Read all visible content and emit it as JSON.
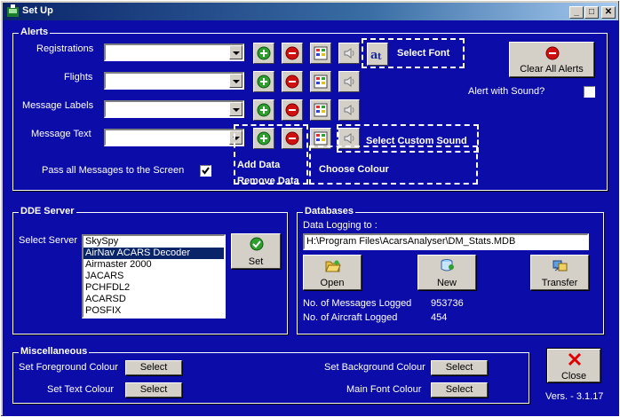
{
  "window": {
    "title": "Set Up",
    "minimize_glyph": "_",
    "maximize_glyph": "□",
    "close_glyph": "✕"
  },
  "alerts": {
    "group_title": "Alerts",
    "rows": [
      {
        "label": "Registrations"
      },
      {
        "label": "Flights"
      },
      {
        "label": "Message Labels"
      },
      {
        "label": "Message Text"
      }
    ],
    "pass_all_label": "Pass all Messages to the Screen",
    "pass_all_checked": true,
    "select_font_label": "Select Font",
    "select_custom_sound_label": "Select Custom Sound",
    "choose_colour_label": "Choose Colour",
    "add_data_label": "Add Data",
    "remove_data_label": "Remove Data",
    "clear_all_alerts_label": "Clear All Alerts",
    "alert_with_sound_label": "Alert with Sound?",
    "alert_with_sound_checked": false
  },
  "dde": {
    "group_title": "DDE Server",
    "select_server_label": "Select Server",
    "servers": [
      "SkySpy",
      "AirNav ACARS Decoder",
      "Airmaster 2000",
      "JACARS",
      "PCHFDL2",
      "ACARSD",
      "POSFIX"
    ],
    "selected_index": 1,
    "set_label": "Set"
  },
  "databases": {
    "group_title": "Databases",
    "data_logging_label": "Data Logging to :",
    "data_logging_path": "H:\\Program Files\\AcarsAnalyser\\DM_Stats.MDB",
    "open_label": "Open",
    "new_label": "New",
    "transfer_label": "Transfer",
    "messages_logged_label": "No. of Messages Logged",
    "messages_logged_value": "953736",
    "aircraft_logged_label": "No. of Aircraft Logged",
    "aircraft_logged_value": "454"
  },
  "misc": {
    "group_title": "Miscellaneous",
    "fg_colour_label": "Set Foreground Colour",
    "text_colour_label": "Set Text Colour",
    "bg_colour_label": "Set Background Colour",
    "main_font_colour_label": "Main Font Colour",
    "select_label": "Select"
  },
  "close_label": "Close",
  "version": "Vers. - 3.1.17",
  "colors": {
    "background": "#0c0ca8",
    "titlebar": "#0a246a",
    "selection": "#0a246a",
    "add_icon": "#2e9e2e",
    "remove_icon": "#d01010",
    "close_x": "#e00000"
  },
  "icons": [
    "app-icon",
    "add-icon",
    "remove-icon",
    "colour-palette-icon",
    "sound-icon",
    "font-icon",
    "no-entry-icon",
    "check-icon",
    "open-folder-icon",
    "new-db-icon",
    "transfer-icon",
    "close-x-icon"
  ]
}
